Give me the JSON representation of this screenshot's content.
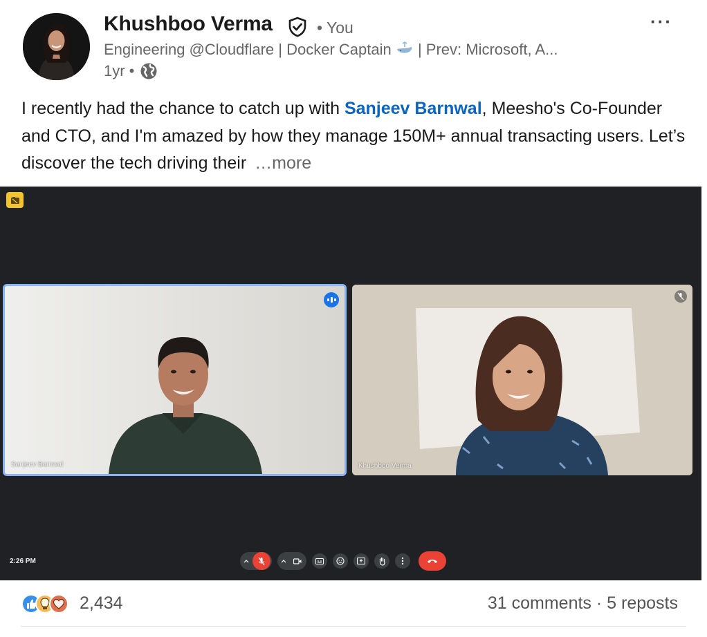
{
  "author": {
    "name": "Khushboo Verma",
    "relation": "• You",
    "headline": "Engineering @Cloudflare | Docker Captain",
    "headline_rest": "| Prev: Microsoft, A...",
    "time": "1yr •",
    "visibility_icon": "globe-icon"
  },
  "post": {
    "text_before": "I recently had the chance to catch up with ",
    "mention": "Sanjeev Barnwal",
    "text_after": ", Meesho's Co-Founder and CTO, and I'm amazed by how they manage 150M+ annual transacting users. Let’s discover the tech driving their",
    "see_more": "…more"
  },
  "video": {
    "participants": [
      {
        "name": "Sanjeev Barnwal",
        "state": "speaking"
      },
      {
        "name": "Khushboo Verma",
        "state": "muted"
      }
    ],
    "clock": "2:26 PM",
    "controls": [
      "mic-muted",
      "camera",
      "captions",
      "emoji",
      "present",
      "raise-hand",
      "more-options",
      "leave-call"
    ]
  },
  "social": {
    "reaction_icons": [
      "like-icon",
      "insightful-icon",
      "love-icon"
    ],
    "reaction_count": "2,434",
    "comments_reposts": "31 comments · 5 reposts"
  },
  "colors": {
    "mention_blue": "#0a66c2",
    "meet_background": "#202124",
    "active_speaker_border": "#8ab4f8",
    "hangup_red": "#ea4335",
    "recording_badge": "#f4c430"
  }
}
